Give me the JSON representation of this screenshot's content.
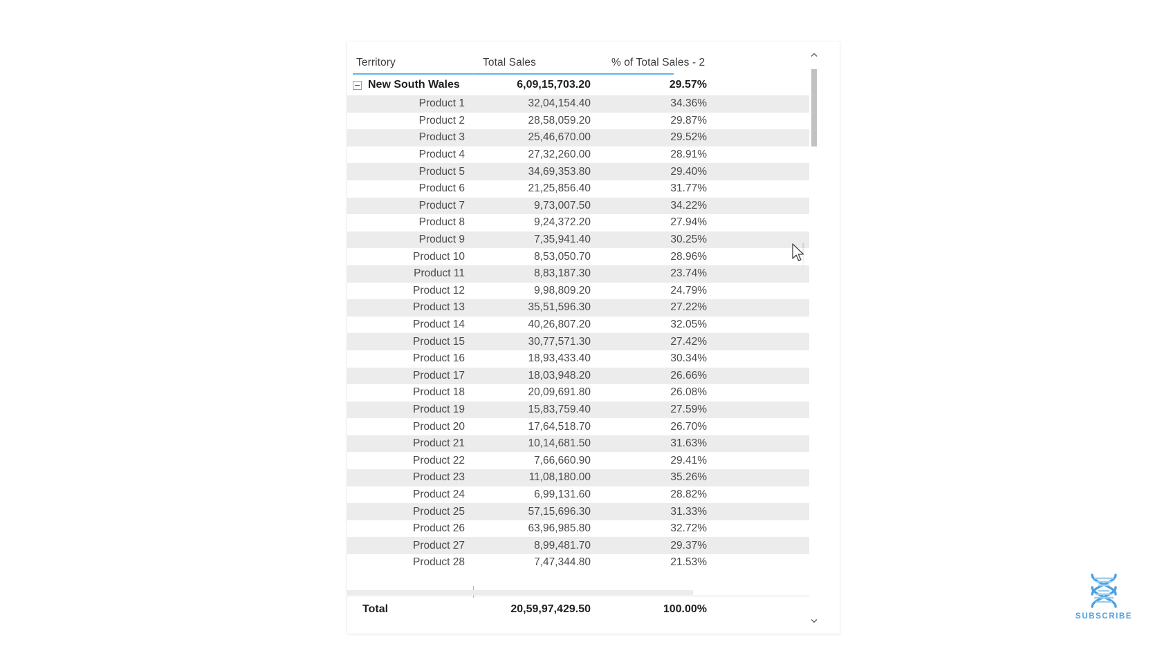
{
  "visual": {
    "type": "matrix-table",
    "columns": [
      {
        "key": "territory",
        "label": "Territory",
        "align": "left"
      },
      {
        "key": "total_sales",
        "label": "Total Sales",
        "align": "right"
      },
      {
        "key": "pct_total_sales",
        "label": "% of Total Sales - 2",
        "align": "right"
      }
    ],
    "group_row": {
      "name": "New South Wales",
      "total_sales": "6,09,15,703.20",
      "pct_total_sales": "29.57%",
      "expander_state": "expanded",
      "expander_icon": "minus-box-icon"
    },
    "rows": [
      {
        "name": "Product 1",
        "total_sales": "32,04,154.40",
        "pct_total_sales": "34.36%"
      },
      {
        "name": "Product 2",
        "total_sales": "28,58,059.20",
        "pct_total_sales": "29.87%"
      },
      {
        "name": "Product 3",
        "total_sales": "25,46,670.00",
        "pct_total_sales": "29.52%"
      },
      {
        "name": "Product 4",
        "total_sales": "27,32,260.00",
        "pct_total_sales": "28.91%"
      },
      {
        "name": "Product 5",
        "total_sales": "34,69,353.80",
        "pct_total_sales": "29.40%"
      },
      {
        "name": "Product 6",
        "total_sales": "21,25,856.40",
        "pct_total_sales": "31.77%"
      },
      {
        "name": "Product 7",
        "total_sales": "9,73,007.50",
        "pct_total_sales": "34.22%"
      },
      {
        "name": "Product 8",
        "total_sales": "9,24,372.20",
        "pct_total_sales": "27.94%"
      },
      {
        "name": "Product 9",
        "total_sales": "7,35,941.40",
        "pct_total_sales": "30.25%"
      },
      {
        "name": "Product 10",
        "total_sales": "8,53,050.70",
        "pct_total_sales": "28.96%"
      },
      {
        "name": "Product 11",
        "total_sales": "8,83,187.30",
        "pct_total_sales": "23.74%"
      },
      {
        "name": "Product 12",
        "total_sales": "9,98,809.20",
        "pct_total_sales": "24.79%"
      },
      {
        "name": "Product 13",
        "total_sales": "35,51,596.30",
        "pct_total_sales": "27.22%"
      },
      {
        "name": "Product 14",
        "total_sales": "40,26,807.20",
        "pct_total_sales": "32.05%"
      },
      {
        "name": "Product 15",
        "total_sales": "30,77,571.30",
        "pct_total_sales": "27.42%"
      },
      {
        "name": "Product 16",
        "total_sales": "18,93,433.40",
        "pct_total_sales": "30.34%"
      },
      {
        "name": "Product 17",
        "total_sales": "18,03,948.20",
        "pct_total_sales": "26.66%"
      },
      {
        "name": "Product 18",
        "total_sales": "20,09,691.80",
        "pct_total_sales": "26.08%"
      },
      {
        "name": "Product 19",
        "total_sales": "15,83,759.40",
        "pct_total_sales": "27.59%"
      },
      {
        "name": "Product 20",
        "total_sales": "17,64,518.70",
        "pct_total_sales": "26.70%"
      },
      {
        "name": "Product 21",
        "total_sales": "10,14,681.50",
        "pct_total_sales": "31.63%"
      },
      {
        "name": "Product 22",
        "total_sales": "7,66,660.90",
        "pct_total_sales": "29.41%"
      },
      {
        "name": "Product 23",
        "total_sales": "11,08,180.00",
        "pct_total_sales": "35.26%"
      },
      {
        "name": "Product 24",
        "total_sales": "6,99,131.60",
        "pct_total_sales": "28.82%"
      },
      {
        "name": "Product 25",
        "total_sales": "57,15,696.30",
        "pct_total_sales": "31.33%"
      },
      {
        "name": "Product 26",
        "total_sales": "63,96,985.80",
        "pct_total_sales": "32.72%"
      },
      {
        "name": "Product 27",
        "total_sales": "8,99,481.70",
        "pct_total_sales": "29.37%"
      },
      {
        "name": "Product 28",
        "total_sales": "7,47,344.80",
        "pct_total_sales": "21.53%"
      }
    ],
    "total_row": {
      "name": "Total",
      "total_sales": "20,59,97,429.50",
      "pct_total_sales": "100.00%"
    }
  },
  "scrollbar": {
    "up_icon": "chevron-up-icon",
    "down_icon": "chevron-down-icon",
    "thumb_name": "scrollbar-thumb"
  },
  "watermark": {
    "label": "SUBSCRIBE",
    "icon": "dna-helix-icon",
    "color": "#4a9fe0"
  },
  "colors": {
    "accent": "#5eb3ea",
    "column_separator": "#7cc2ef",
    "alt_row": "#ececec",
    "text": "#4a4a4a",
    "text_strong": "#1f1f1f"
  }
}
